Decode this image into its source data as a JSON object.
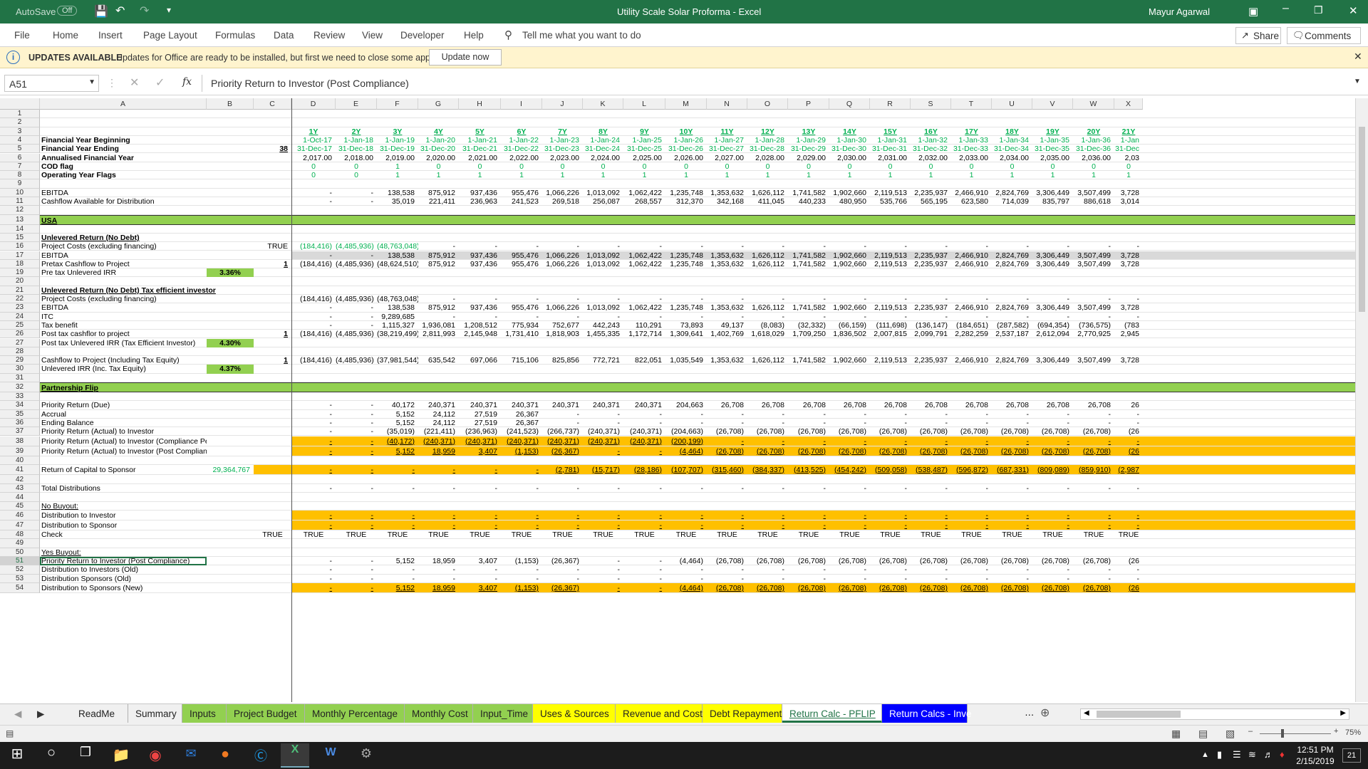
{
  "window": {
    "title": "Utility Scale Solar Proforma  -  Excel",
    "autosave_label": "AutoSave",
    "autosave_state": "Off",
    "user": "Mayur Agarwal"
  },
  "ribbon": {
    "tabs": [
      "File",
      "Home",
      "Insert",
      "Page Layout",
      "Formulas",
      "Data",
      "Review",
      "View",
      "Developer",
      "Help"
    ],
    "tell_me": "Tell me what you want to do",
    "share": "Share",
    "comments": "Comments"
  },
  "update_bar": {
    "title": "UPDATES AVAILABLE",
    "message": "Updates for Office are ready to be installed, but first we need to close some apps.",
    "button": "Update now"
  },
  "formula_bar": {
    "name_box": "A51",
    "fx": "fx",
    "formula": "Priority Return to Investor (Post Compliance)"
  },
  "columns": [
    "A",
    "B",
    "C",
    "D",
    "E",
    "F",
    "G",
    "H",
    "I",
    "J",
    "K",
    "L",
    "M",
    "N",
    "O",
    "P",
    "Q",
    "R",
    "S",
    "T",
    "U",
    "V",
    "W",
    "X"
  ],
  "rows": [
    {
      "n": "1",
      "cells": []
    },
    {
      "n": "2",
      "cells": []
    },
    {
      "n": "3",
      "style": "years",
      "cells": [
        "",
        "",
        "",
        "1Y",
        "2Y",
        "3Y",
        "4Y",
        "5Y",
        "6Y",
        "7Y",
        "8Y",
        "9Y",
        "10Y",
        "11Y",
        "12Y",
        "13Y",
        "14Y",
        "15Y",
        "16Y",
        "17Y",
        "18Y",
        "19Y",
        "20Y",
        "21Y"
      ]
    },
    {
      "n": "4",
      "style": "dates",
      "cells": [
        "Financial Year Beginning",
        "",
        "",
        "1-Oct-17",
        "1-Jan-18",
        "1-Jan-19",
        "1-Jan-20",
        "1-Jan-21",
        "1-Jan-22",
        "1-Jan-23",
        "1-Jan-24",
        "1-Jan-25",
        "1-Jan-26",
        "1-Jan-27",
        "1-Jan-28",
        "1-Jan-29",
        "1-Jan-30",
        "1-Jan-31",
        "1-Jan-32",
        "1-Jan-33",
        "1-Jan-34",
        "1-Jan-35",
        "1-Jan-36",
        "1-Jan"
      ]
    },
    {
      "n": "5",
      "style": "dates",
      "cells": [
        "Financial Year Ending",
        "",
        "38",
        "31-Dec-17",
        "31-Dec-18",
        "31-Dec-19",
        "31-Dec-20",
        "31-Dec-21",
        "31-Dec-22",
        "31-Dec-23",
        "31-Dec-24",
        "31-Dec-25",
        "31-Dec-26",
        "31-Dec-27",
        "31-Dec-28",
        "31-Dec-29",
        "31-Dec-30",
        "31-Dec-31",
        "31-Dec-32",
        "31-Dec-33",
        "31-Dec-34",
        "31-Dec-35",
        "31-Dec-36",
        "31-Dec"
      ]
    },
    {
      "n": "6",
      "style": "boldlabel",
      "cells": [
        "Annualised Financial Year",
        "",
        "",
        "2,017.00",
        "2,018.00",
        "2,019.00",
        "2,020.00",
        "2,021.00",
        "2,022.00",
        "2,023.00",
        "2,024.00",
        "2,025.00",
        "2,026.00",
        "2,027.00",
        "2,028.00",
        "2,029.00",
        "2,030.00",
        "2,031.00",
        "2,032.00",
        "2,033.00",
        "2,034.00",
        "2,035.00",
        "2,036.00",
        "2,03"
      ]
    },
    {
      "n": "7",
      "style": "flags",
      "cells": [
        "COD flag",
        "",
        "",
        "0",
        "0",
        "1",
        "0",
        "0",
        "0",
        "0",
        "0",
        "0",
        "0",
        "0",
        "0",
        "0",
        "0",
        "0",
        "0",
        "0",
        "0",
        "0",
        "0",
        "0"
      ]
    },
    {
      "n": "8",
      "style": "flags",
      "cells": [
        "Operating Year Flags",
        "",
        "",
        "0",
        "0",
        "1",
        "1",
        "1",
        "1",
        "1",
        "1",
        "1",
        "1",
        "1",
        "1",
        "1",
        "1",
        "1",
        "1",
        "1",
        "1",
        "1",
        "1",
        "1"
      ]
    },
    {
      "n": "9",
      "cells": []
    },
    {
      "n": "10",
      "cells": [
        "EBITDA",
        "",
        "",
        "-",
        "-",
        "138,538",
        "875,912",
        "937,436",
        "955,476",
        "1,066,226",
        "1,013,092",
        "1,062,422",
        "1,235,748",
        "1,353,632",
        "1,626,112",
        "1,741,582",
        "1,902,660",
        "2,119,513",
        "2,235,937",
        "2,466,910",
        "2,824,769",
        "3,306,449",
        "3,507,499",
        "3,728"
      ]
    },
    {
      "n": "11",
      "cells": [
        "Cashflow Available for Distribution",
        "",
        "",
        "-",
        "-",
        "35,019",
        "221,411",
        "236,963",
        "241,523",
        "269,518",
        "256,087",
        "268,557",
        "312,370",
        "342,168",
        "411,045",
        "440,233",
        "480,950",
        "535,766",
        "565,195",
        "623,580",
        "714,039",
        "835,797",
        "886,618",
        "3,014"
      ]
    },
    {
      "n": "12",
      "cells": []
    },
    {
      "n": "13",
      "style": "section",
      "cells": [
        "USA"
      ]
    },
    {
      "n": "14",
      "cells": []
    },
    {
      "n": "15",
      "style": "heading",
      "cells": [
        "Unlevered Return (No Debt)"
      ]
    },
    {
      "n": "16",
      "style": "greenvals",
      "cells": [
        "Project Costs (excluding financing)",
        "",
        "TRUE",
        "(184,416)",
        "(4,485,936)",
        "(48,763,048)",
        "-",
        "-",
        "-",
        "-",
        "-",
        "-",
        "-",
        "-",
        "-",
        "-",
        "-",
        "-",
        "-",
        "-",
        "-",
        "-",
        "-",
        "-"
      ]
    },
    {
      "n": "17",
      "style": "grey",
      "cells": [
        "EBITDA",
        "",
        "",
        "-",
        "-",
        "138,538",
        "875,912",
        "937,436",
        "955,476",
        "1,066,226",
        "1,013,092",
        "1,062,422",
        "1,235,748",
        "1,353,632",
        "1,626,112",
        "1,741,582",
        "1,902,660",
        "2,119,513",
        "2,235,937",
        "2,466,910",
        "2,824,769",
        "3,306,449",
        "3,507,499",
        "3,728"
      ]
    },
    {
      "n": "18",
      "style": "check",
      "cells": [
        "Pretax Cashflow to Project",
        "",
        "1",
        "(184,416)",
        "(4,485,936)",
        "(48,624,510)",
        "875,912",
        "937,436",
        "955,476",
        "1,066,226",
        "1,013,092",
        "1,062,422",
        "1,235,748",
        "1,353,632",
        "1,626,112",
        "1,741,582",
        "1,902,660",
        "2,119,513",
        "2,235,937",
        "2,466,910",
        "2,824,769",
        "3,306,449",
        "3,507,499",
        "3,728"
      ]
    },
    {
      "n": "19",
      "style": "irr",
      "cells": [
        "Pre tax Unlevered IRR",
        "3.36%"
      ]
    },
    {
      "n": "20",
      "cells": []
    },
    {
      "n": "21",
      "style": "heading",
      "cells": [
        "Unlevered Return (No Debt) Tax efficient investor"
      ]
    },
    {
      "n": "22",
      "cells": [
        "Project Costs (excluding financing)",
        "",
        "",
        "(184,416)",
        "(4,485,936)",
        "(48,763,048)",
        "-",
        "-",
        "-",
        "-",
        "-",
        "-",
        "-",
        "-",
        "-",
        "-",
        "-",
        "-",
        "-",
        "-",
        "-",
        "-",
        "-",
        "-"
      ]
    },
    {
      "n": "23",
      "cells": [
        "EBITDA",
        "",
        "",
        "-",
        "-",
        "138,538",
        "875,912",
        "937,436",
        "955,476",
        "1,066,226",
        "1,013,092",
        "1,062,422",
        "1,235,748",
        "1,353,632",
        "1,626,112",
        "1,741,582",
        "1,902,660",
        "2,119,513",
        "2,235,937",
        "2,466,910",
        "2,824,769",
        "3,306,449",
        "3,507,499",
        "3,728"
      ]
    },
    {
      "n": "24",
      "cells": [
        "ITC",
        "",
        "",
        "-",
        "-",
        "9,289,685",
        "-",
        "-",
        "-",
        "-",
        "-",
        "-",
        "-",
        "-",
        "-",
        "-",
        "-",
        "-",
        "-",
        "-",
        "-",
        "-",
        "-",
        "-"
      ]
    },
    {
      "n": "25",
      "cells": [
        "Tax benefit",
        "",
        "",
        "-",
        "-",
        "1,115,327",
        "1,936,081",
        "1,208,512",
        "775,934",
        "752,677",
        "442,243",
        "110,291",
        "73,893",
        "49,137",
        "(8,083)",
        "(32,332)",
        "(66,159)",
        "(111,698)",
        "(136,147)",
        "(184,651)",
        "(287,582)",
        "(694,354)",
        "(736,575)",
        "(783"
      ]
    },
    {
      "n": "26",
      "style": "check",
      "cells": [
        "Post tax cashflor to project",
        "",
        "1",
        "(184,416)",
        "(4,485,936)",
        "(38,219,499)",
        "2,811,993",
        "2,145,948",
        "1,731,410",
        "1,818,903",
        "1,455,335",
        "1,172,714",
        "1,309,641",
        "1,402,769",
        "1,618,029",
        "1,709,250",
        "1,836,502",
        "2,007,815",
        "2,099,791",
        "2,282,259",
        "2,537,187",
        "2,612,094",
        "2,770,925",
        "2,945"
      ]
    },
    {
      "n": "27",
      "style": "irr",
      "cells": [
        "Post tax Unlevered IRR (Tax Efficient Investor)",
        "4.30%"
      ]
    },
    {
      "n": "28",
      "cells": []
    },
    {
      "n": "29",
      "style": "check",
      "cells": [
        "Cashflow to Project (Including Tax Equity)",
        "",
        "1",
        "(184,416)",
        "(4,485,936)",
        "(37,981,544)",
        "635,542",
        "697,066",
        "715,106",
        "825,856",
        "772,721",
        "822,051",
        "1,035,549",
        "1,353,632",
        "1,626,112",
        "1,741,582",
        "1,902,660",
        "2,119,513",
        "2,235,937",
        "2,466,910",
        "2,824,769",
        "3,306,449",
        "3,507,499",
        "3,728"
      ]
    },
    {
      "n": "30",
      "style": "irr",
      "cells": [
        "Unlevered IRR (Inc. Tax Equity)",
        "4.37%"
      ]
    },
    {
      "n": "31",
      "cells": []
    },
    {
      "n": "32",
      "style": "section",
      "cells": [
        "Partnership Flip"
      ]
    },
    {
      "n": "33",
      "cells": []
    },
    {
      "n": "34",
      "cells": [
        "Priority Return (Due)",
        "",
        "",
        "-",
        "-",
        "40,172",
        "240,371",
        "240,371",
        "240,371",
        "240,371",
        "240,371",
        "240,371",
        "204,663",
        "26,708",
        "26,708",
        "26,708",
        "26,708",
        "26,708",
        "26,708",
        "26,708",
        "26,708",
        "26,708",
        "26,708",
        "26"
      ]
    },
    {
      "n": "35",
      "cells": [
        "Accrual",
        "",
        "",
        "-",
        "-",
        "5,152",
        "24,112",
        "27,519",
        "26,367",
        "-",
        "-",
        "-",
        "-",
        "-",
        "-",
        "-",
        "-",
        "-",
        "-",
        "-",
        "-",
        "-",
        "-",
        "-"
      ]
    },
    {
      "n": "36",
      "cells": [
        "Ending Balance",
        "",
        "",
        "-",
        "-",
        "5,152",
        "24,112",
        "27,519",
        "26,367",
        "-",
        "-",
        "-",
        "-",
        "-",
        "-",
        "-",
        "-",
        "-",
        "-",
        "-",
        "-",
        "-",
        "-",
        "-"
      ]
    },
    {
      "n": "37",
      "cells": [
        "Priority Return (Actual) to Investor",
        "",
        "",
        "-",
        "-",
        "(35,019)",
        "(221,411)",
        "(236,963)",
        "(241,523)",
        "(266,737)",
        "(240,371)",
        "(240,371)",
        "(204,663)",
        "(26,708)",
        "(26,708)",
        "(26,708)",
        "(26,708)",
        "(26,708)",
        "(26,708)",
        "(26,708)",
        "(26,708)",
        "(26,708)",
        "(26,708)",
        "(26"
      ]
    },
    {
      "n": "38",
      "style": "orange",
      "cells": [
        "Priority Return (Actual) to Investor (Compliance Period)",
        "",
        "",
        "-",
        "-",
        "(40,172)",
        "(240,371)",
        "(240,371)",
        "(240,371)",
        "(240,371)",
        "(240,371)",
        "(240,371)",
        "(200,199)",
        "-",
        "-",
        "-",
        "-",
        "-",
        "-",
        "-",
        "-",
        "-",
        "-",
        "-"
      ]
    },
    {
      "n": "39",
      "style": "orange",
      "cells": [
        "Priority Return (Actual) to Investor (Post Compliance)",
        "",
        "",
        "-",
        "-",
        "5,152",
        "18,959",
        "3,407",
        "(1,153)",
        "(26,367)",
        "-",
        "-",
        "(4,464)",
        "(26,708)",
        "(26,708)",
        "(26,708)",
        "(26,708)",
        "(26,708)",
        "(26,708)",
        "(26,708)",
        "(26,708)",
        "(26,708)",
        "(26,708)",
        "(26"
      ]
    },
    {
      "n": "40",
      "cells": []
    },
    {
      "n": "41",
      "style": "orange41",
      "cells": [
        "Return of Capital to Sponsor",
        "29,364,767",
        "",
        "-",
        "-",
        "-",
        "-",
        "-",
        "-",
        "(2,781)",
        "(15,717)",
        "(28,186)",
        "(107,707)",
        "(315,460)",
        "(384,337)",
        "(413,525)",
        "(454,242)",
        "(509,058)",
        "(538,487)",
        "(596,872)",
        "(687,331)",
        "(809,089)",
        "(859,910)",
        "(2,987"
      ]
    },
    {
      "n": "42",
      "cells": []
    },
    {
      "n": "43",
      "cells": [
        "Total Distributions",
        "",
        "",
        "-",
        "-",
        "-",
        "-",
        "-",
        "-",
        "-",
        "-",
        "-",
        "-",
        "-",
        "-",
        "-",
        "-",
        "-",
        "-",
        "-",
        "-",
        "-",
        "-",
        "-"
      ]
    },
    {
      "n": "44",
      "cells": []
    },
    {
      "n": "45",
      "style": "subhead",
      "cells": [
        "No Buyout:"
      ]
    },
    {
      "n": "46",
      "style": "orange",
      "cells": [
        "Distribution to Investor",
        "",
        "",
        "-",
        "-",
        "-",
        "-",
        "-",
        "-",
        "-",
        "-",
        "-",
        "-",
        "-",
        "-",
        "-",
        "-",
        "-",
        "-",
        "-",
        "-",
        "-",
        "-",
        "-"
      ]
    },
    {
      "n": "47",
      "style": "orange",
      "cells": [
        "Distribution to Sponsor",
        "",
        "",
        "-",
        "-",
        "-",
        "-",
        "-",
        "-",
        "-",
        "-",
        "-",
        "-",
        "-",
        "-",
        "-",
        "-",
        "-",
        "-",
        "-",
        "-",
        "-",
        "-",
        "-"
      ]
    },
    {
      "n": "48",
      "cells": [
        "Check",
        "",
        "TRUE",
        "TRUE",
        "TRUE",
        "TRUE",
        "TRUE",
        "TRUE",
        "TRUE",
        "TRUE",
        "TRUE",
        "TRUE",
        "TRUE",
        "TRUE",
        "TRUE",
        "TRUE",
        "TRUE",
        "TRUE",
        "TRUE",
        "TRUE",
        "TRUE",
        "TRUE",
        "TRUE",
        "TRUE"
      ]
    },
    {
      "n": "49",
      "cells": []
    },
    {
      "n": "50",
      "style": "subhead",
      "cells": [
        "Yes Buyout:"
      ]
    },
    {
      "n": "51",
      "style": "selected",
      "cells": [
        "Priority Return to Investor (Post Compliance)",
        "",
        "",
        "-",
        "-",
        "5,152",
        "18,959",
        "3,407",
        "(1,153)",
        "(26,367)",
        "-",
        "-",
        "(4,464)",
        "(26,708)",
        "(26,708)",
        "(26,708)",
        "(26,708)",
        "(26,708)",
        "(26,708)",
        "(26,708)",
        "(26,708)",
        "(26,708)",
        "(26,708)",
        "(26"
      ]
    },
    {
      "n": "52",
      "cells": [
        "Distribution to Investors (Old)",
        "",
        "",
        "-",
        "-",
        "-",
        "-",
        "-",
        "-",
        "-",
        "-",
        "-",
        "-",
        "-",
        "-",
        "-",
        "-",
        "-",
        "-",
        "-",
        "-",
        "-",
        "-",
        "-"
      ]
    },
    {
      "n": "53",
      "cells": [
        "Distribution Sponsors (Old)",
        "",
        "",
        "-",
        "-",
        "-",
        "-",
        "-",
        "-",
        "-",
        "-",
        "-",
        "-",
        "-",
        "-",
        "-",
        "-",
        "-",
        "-",
        "-",
        "-",
        "-",
        "-",
        "-"
      ]
    },
    {
      "n": "54",
      "style": "orange",
      "cells": [
        "Distribution to Sponsors (New)",
        "",
        "",
        "-",
        "-",
        "5,152",
        "18,959",
        "3,407",
        "(1,153)",
        "(26,367)",
        "-",
        "-",
        "(4,464)",
        "(26,708)",
        "(26,708)",
        "(26,708)",
        "(26,708)",
        "(26,708)",
        "(26,708)",
        "(26,708)",
        "(26,708)",
        "(26,708)",
        "(26,708)",
        "(26"
      ]
    }
  ],
  "sheet_tabs": [
    {
      "label": "ReadMe",
      "color": "none"
    },
    {
      "label": "Summary",
      "color": "none"
    },
    {
      "label": "Inputs",
      "color": "green"
    },
    {
      "label": "Project Budget",
      "color": "green"
    },
    {
      "label": "Monthly Percentage",
      "color": "green"
    },
    {
      "label": "Monthly Cost",
      "color": "green"
    },
    {
      "label": "Input_Time",
      "color": "green"
    },
    {
      "label": "Uses & Sources",
      "color": "yellow"
    },
    {
      "label": "Revenue and Costs",
      "color": "yellow"
    },
    {
      "label": "Debt Repayment",
      "color": "yellow"
    },
    {
      "label": "Return Calc - PFLIP",
      "color": "active"
    },
    {
      "label": "Return Calcs - Inve",
      "color": "blue"
    }
  ],
  "status": {
    "zoom": "75%"
  },
  "taskbar": {
    "time": "12:51 PM",
    "date": "2/15/2019",
    "notifications": "21"
  },
  "colors": {
    "excel_green": "#217346",
    "section_green": "#92d050",
    "orange": "#ffc000",
    "flag_green": "#00b050",
    "blue_tab": "#0000ff"
  }
}
